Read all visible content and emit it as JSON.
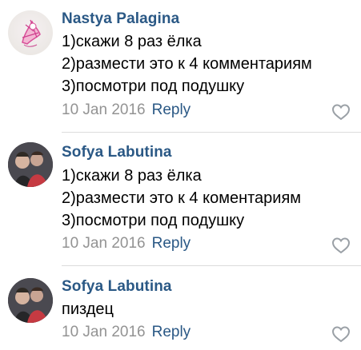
{
  "comments": [
    {
      "author": "Nastya Palagina",
      "lines": [
        "1)скажи 8 раз ёлка",
        "2)размести это к 4 комментариям",
        "3)посмотри под подушку"
      ],
      "date": "10 Jan 2016",
      "reply": "Reply",
      "avatar_icon": "pink-sketch-avatar",
      "like_icon": "heart-outline-icon"
    },
    {
      "author": "Sofya Labutina",
      "lines": [
        "1)скажи 8 раз ёлка",
        "2)размести это к 4 коментариям",
        "3)посмотри под подушку"
      ],
      "date": "10 Jan 2016",
      "reply": "Reply",
      "avatar_icon": "group-photo-avatar",
      "like_icon": "heart-outline-icon"
    },
    {
      "author": "Sofya Labutina",
      "lines": [
        "пиздец"
      ],
      "date": "10 Jan 2016",
      "reply": "Reply",
      "avatar_icon": "group-photo-avatar",
      "like_icon": "heart-outline-icon"
    }
  ],
  "colors": {
    "author": "#2a5885",
    "text": "#000000",
    "date": "#939393",
    "reply": "#2a5885",
    "heart": "#9aa0a6",
    "divider": "#dcdcdc"
  }
}
